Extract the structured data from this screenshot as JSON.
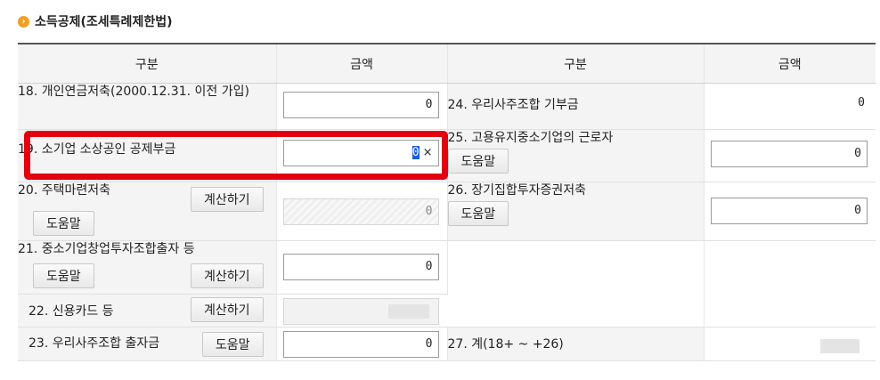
{
  "section": {
    "title": "소득공제(조세특례제한법)",
    "icon": "arrow-right-circle-icon"
  },
  "headers": {
    "col1": "구분",
    "col2": "금액",
    "col3": "구분",
    "col4": "금액"
  },
  "rows": {
    "r18": {
      "label": "18. 개인연금저축(2000.12.31. 이전 가입)",
      "value": "0"
    },
    "r19": {
      "label": "19. 소기업 소상공인 공제부금",
      "value": "0",
      "clear": "×"
    },
    "r20": {
      "label": "20. 주택마련저축",
      "calc": "계산하기",
      "help": "도움말",
      "value": "0"
    },
    "r21": {
      "label": "21. 중소기업창업투자조합출자 등",
      "calc": "계산하기",
      "help": "도움말",
      "value": "0"
    },
    "r22": {
      "label": "22. 신용카드 등",
      "calc": "계산하기"
    },
    "r23": {
      "label": "23. 우리사주조합 출자금",
      "help": "도움말",
      "value": "0"
    },
    "r24": {
      "label": "24. 우리사주조합 기부금",
      "value": "0"
    },
    "r25": {
      "label": "25. 고용유지중소기업의 근로자",
      "help": "도움말",
      "value": "0"
    },
    "r26": {
      "label": "26. 장기집합투자증권저축",
      "help": "도움말",
      "value": "0"
    },
    "r27": {
      "label": "27. 계(18+ ~ +26)"
    }
  },
  "colors": {
    "highlight": "#e3000f",
    "selection": "#1a5fd6",
    "header_bg": "#f4f4f4"
  }
}
